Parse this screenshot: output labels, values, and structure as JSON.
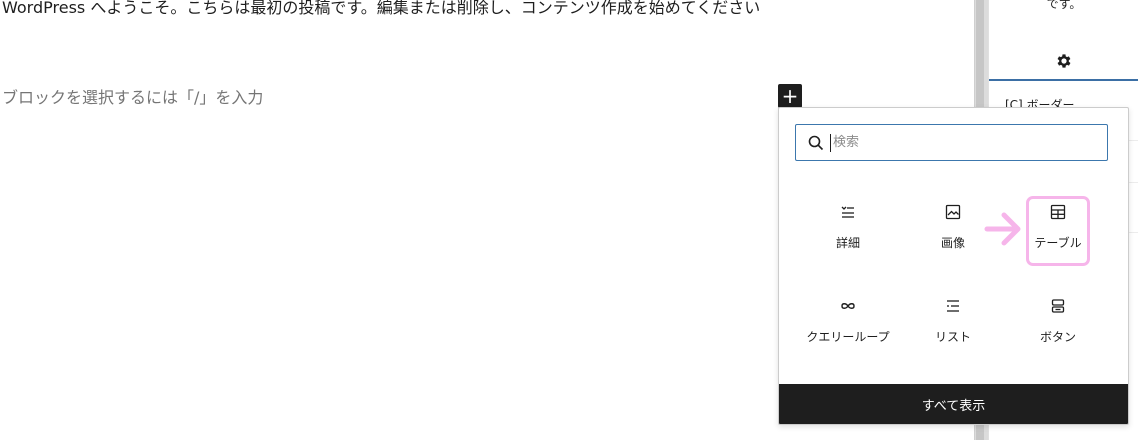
{
  "editor": {
    "post_text": "WordPress へようこそ。こちらは最初の投稿です。編集または削除し、コンテンツ作成を始めてください",
    "placeholder": "ブロックを選択するには「/」を入力",
    "inserter_toggle_icon": "plus-icon"
  },
  "sidebar": {
    "note": "です。",
    "settings_icon": "gear-icon",
    "panel_item": "[C] ボーダー"
  },
  "inserter": {
    "search_placeholder": "検索",
    "blocks": [
      {
        "label": "詳細",
        "icon": "details-icon"
      },
      {
        "label": "画像",
        "icon": "image-icon"
      },
      {
        "label": "テーブル",
        "icon": "table-icon"
      },
      {
        "label": "クエリーループ",
        "icon": "loop-icon"
      },
      {
        "label": "リスト",
        "icon": "list-icon"
      },
      {
        "label": "ボタン",
        "icon": "buttons-icon"
      }
    ],
    "show_all_label": "すべて表示"
  },
  "annotation": {
    "arrow_color": "#f6b5ea",
    "highlight_color": "#f6b5ea"
  },
  "colors": {
    "accent": "#3c77ad",
    "dark": "#1e1e1e"
  }
}
